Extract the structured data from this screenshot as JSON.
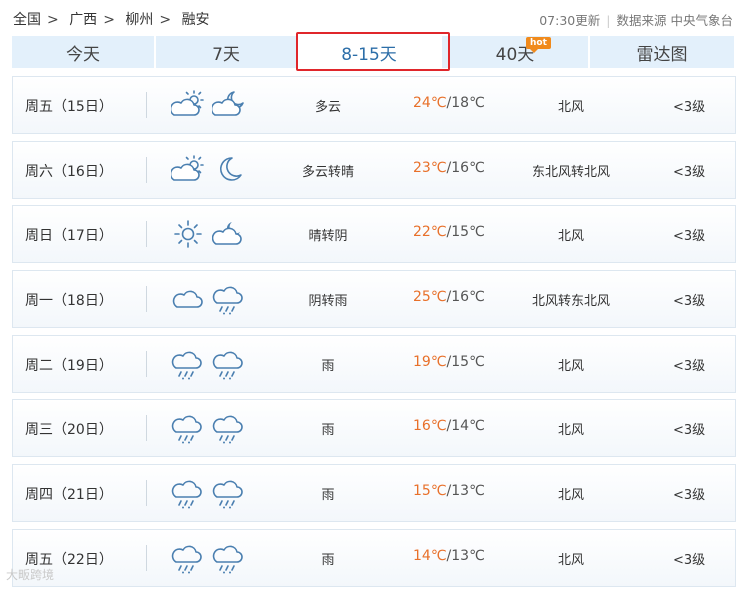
{
  "breadcrumb": {
    "items": [
      "全国",
      "广西",
      "柳州",
      "融安"
    ],
    "separator": ">"
  },
  "meta": {
    "updated": "07:30更新",
    "source_label": "数据来源",
    "source": "中央气象台"
  },
  "tabs": [
    {
      "label": "今天"
    },
    {
      "label": "7天"
    },
    {
      "label": "8-15天",
      "active": true
    },
    {
      "label": "40天",
      "badge": "hot"
    },
    {
      "label": "雷达图"
    }
  ],
  "days": [
    {
      "day": "周五（15日）",
      "icon1": "partly-cloudy-day-icon",
      "icon2": "partly-cloudy-night-icon",
      "condition": "多云",
      "high": "24℃",
      "low": "/18℃",
      "wind": "北风",
      "level": "<3级"
    },
    {
      "day": "周六（16日）",
      "icon1": "partly-cloudy-day-icon",
      "icon2": "moon-icon",
      "condition": "多云转晴",
      "high": "23℃",
      "low": "/16℃",
      "wind": "东北风转北风",
      "level": "<3级"
    },
    {
      "day": "周日（17日）",
      "icon1": "sun-icon",
      "icon2": "cloudy-night-icon",
      "condition": "晴转阴",
      "high": "22℃",
      "low": "/15℃",
      "wind": "北风",
      "level": "<3级"
    },
    {
      "day": "周一（18日）",
      "icon1": "cloud-icon",
      "icon2": "rain-icon",
      "condition": "阴转雨",
      "high": "25℃",
      "low": "/16℃",
      "wind": "北风转东北风",
      "level": "<3级"
    },
    {
      "day": "周二（19日）",
      "icon1": "rain-icon",
      "icon2": "rain-icon",
      "condition": "雨",
      "high": "19℃",
      "low": "/15℃",
      "wind": "北风",
      "level": "<3级"
    },
    {
      "day": "周三（20日）",
      "icon1": "rain-icon",
      "icon2": "rain-icon",
      "condition": "雨",
      "high": "16℃",
      "low": "/14℃",
      "wind": "北风",
      "level": "<3级"
    },
    {
      "day": "周四（21日）",
      "icon1": "rain-icon",
      "icon2": "rain-icon",
      "condition": "雨",
      "high": "15℃",
      "low": "/13℃",
      "wind": "北风",
      "level": "<3级"
    },
    {
      "day": "周五（22日）",
      "icon1": "rain-icon",
      "icon2": "rain-icon",
      "condition": "雨",
      "high": "14℃",
      "low": "/13℃",
      "wind": "北风",
      "level": "<3级"
    }
  ],
  "watermark": "大畈跨境",
  "colors": {
    "high_temp": "#e8702a",
    "tab_bg": "#e3f0fb",
    "active_border": "#e0262b",
    "hot_badge": "#f08a1c",
    "icon": "#4a7fb0"
  }
}
